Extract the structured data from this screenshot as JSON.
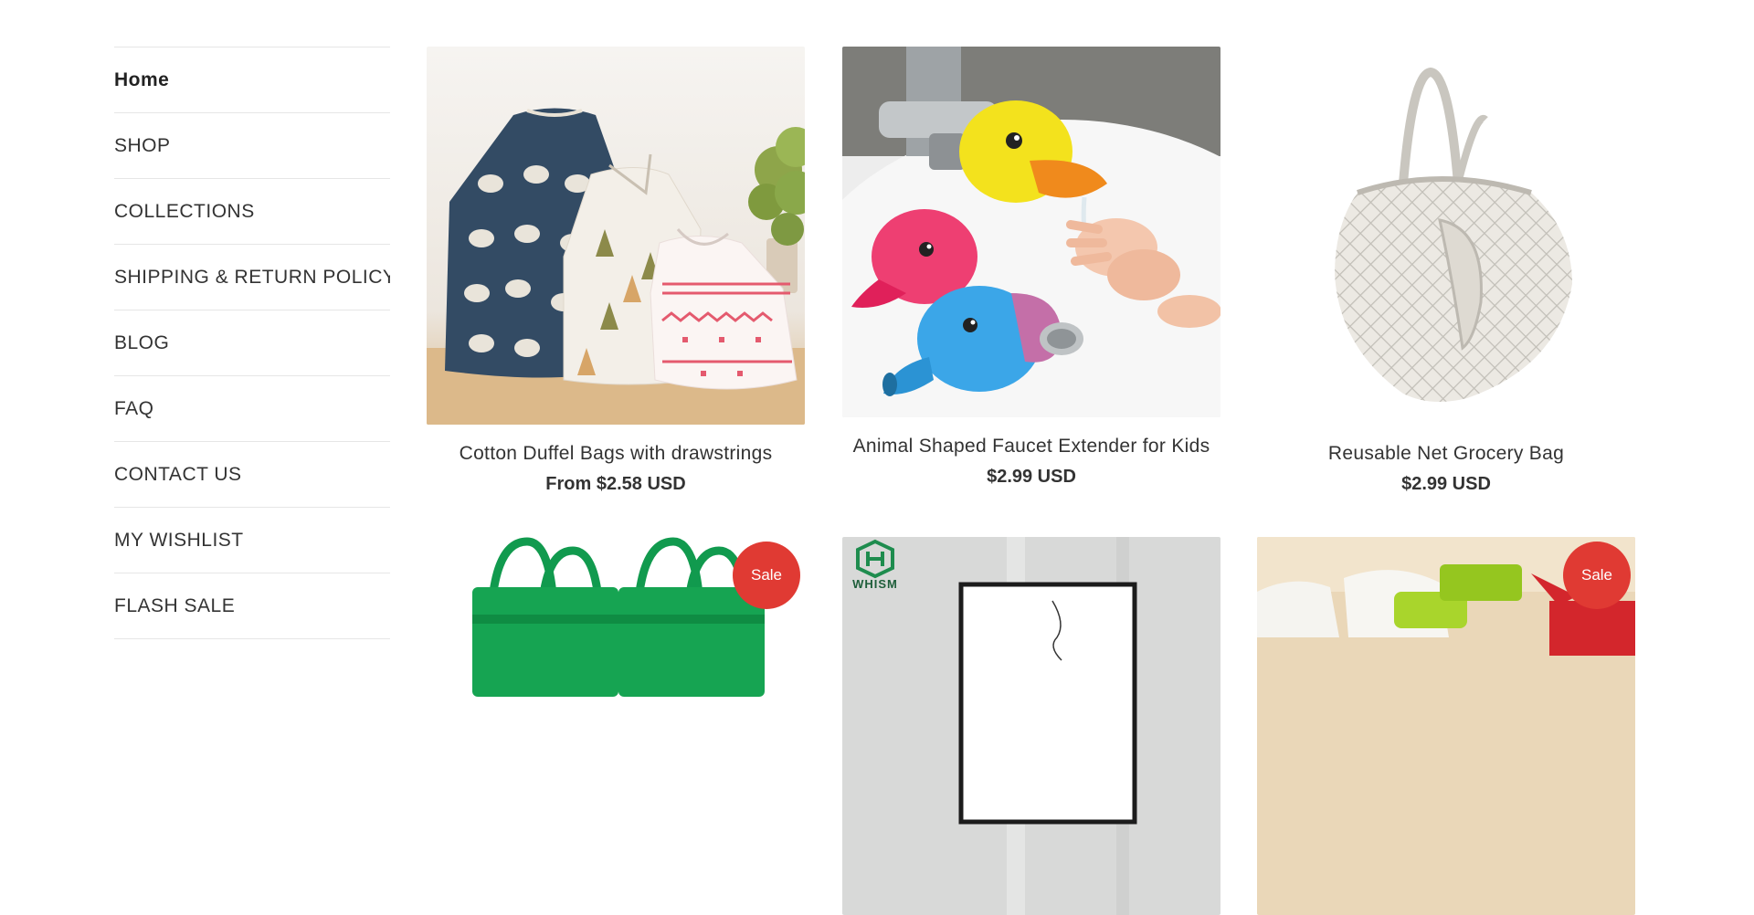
{
  "nav": {
    "items": [
      {
        "label": "Home",
        "active": true
      },
      {
        "label": "SHOP"
      },
      {
        "label": "COLLECTIONS"
      },
      {
        "label": "SHIPPING & RETURN POLICY"
      },
      {
        "label": "BLOG"
      },
      {
        "label": "FAQ"
      },
      {
        "label": "CONTACT US"
      },
      {
        "label": "MY WISHLIST"
      },
      {
        "label": "FLASH SALE"
      }
    ]
  },
  "products": [
    {
      "title": "Cotton Duffel Bags with drawstrings",
      "price": "From $2.58 USD",
      "image_icon": "drawstring-bags-image"
    },
    {
      "title": "Animal Shaped Faucet Extender for Kids",
      "price": "$2.99 USD",
      "image_icon": "faucet-extender-image"
    },
    {
      "title": "Reusable Net Grocery Bag",
      "price": "$2.99 USD",
      "image_icon": "net-bag-image"
    },
    {
      "badge": "Sale",
      "image_icon": "green-cart-bags-image"
    },
    {
      "brand_logo_text": "WHISM",
      "image_icon": "frame-art-image"
    },
    {
      "badge": "Sale",
      "image_icon": "kitchen-gadget-image"
    }
  ],
  "colors": {
    "sale_badge": "#e03a33",
    "text": "#333333",
    "divider": "#e6e6e6"
  }
}
